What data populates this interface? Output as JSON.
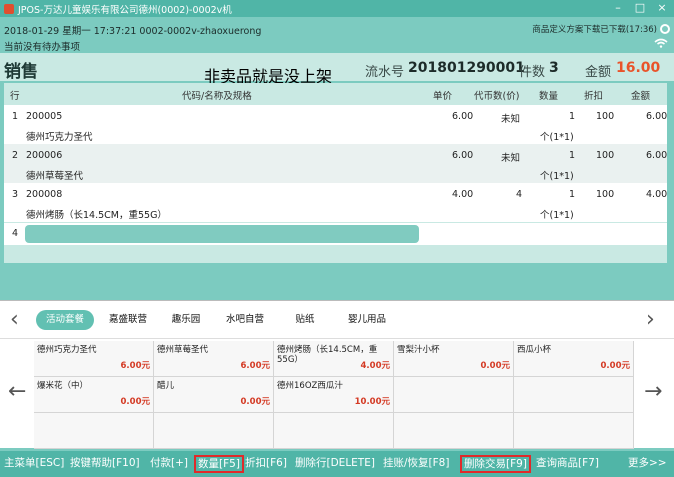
{
  "window": {
    "title": "JPOS-万达儿童娱乐有限公司德州(0002)-0002v机",
    "controls": [
      "–",
      "□",
      "×"
    ]
  },
  "info": {
    "line1": "2018-01-29 星期一 17:37:21 0002-0002v-zhaoxuerong",
    "line2": "当前没有待办事项",
    "sync": "商品定义方案下载已下载(17:36)"
  },
  "sales": {
    "title": "销售",
    "banner": "非卖品就是没上架",
    "serial_label": "流水号",
    "serial": "201801290001",
    "count_label": "件数",
    "count": "3",
    "amount_label": "金额",
    "amount": "16.00"
  },
  "table": {
    "headers": {
      "line": "行",
      "code_name": "代码/名称及规格",
      "price": "单价",
      "coupon": "代币数(价)",
      "qty": "数量",
      "discount": "折扣",
      "amount": "金额"
    },
    "rows": [
      {
        "no": "1",
        "code": "200005",
        "name": "德州巧克力圣代",
        "price": "6.00",
        "coupon": "未知",
        "qty": "1",
        "unit": "个(1*1)",
        "discount": "100",
        "amount": "6.00"
      },
      {
        "no": "2",
        "code": "200006",
        "name": "德州草莓圣代",
        "price": "6.00",
        "coupon": "未知",
        "qty": "1",
        "unit": "个(1*1)",
        "discount": "100",
        "amount": "6.00"
      },
      {
        "no": "3",
        "code": "200008",
        "name": "德州烤肠（长14.5CM，重55G）",
        "price": "4.00",
        "coupon": "4",
        "qty": "1",
        "unit": "个(1*1)",
        "discount": "100",
        "amount": "4.00"
      }
    ],
    "edit_row_no": "4"
  },
  "categories": [
    "活动套餐",
    "嘉盛联营",
    "趣乐园",
    "水吧自营",
    "贴纸",
    "婴儿用品"
  ],
  "products": [
    {
      "name": "德州巧克力圣代",
      "price": "6.00元"
    },
    {
      "name": "德州草莓圣代",
      "price": "6.00元"
    },
    {
      "name": "德州烤肠（长14.5CM，重55G）",
      "price": "4.00元"
    },
    {
      "name": "雪梨汁小杯",
      "price": "0.00元"
    },
    {
      "name": "西瓜小杯",
      "price": "0.00元"
    },
    {
      "name": "爆米花（中）",
      "price": "0.00元"
    },
    {
      "name": "醋儿",
      "price": "0.00元"
    },
    {
      "name": "德州16OZ西瓜汁",
      "price": "10.00元"
    }
  ],
  "function_keys": [
    {
      "label": "主菜单[ESC]",
      "hl": false
    },
    {
      "label": "按键帮助[F10]",
      "hl": false
    },
    {
      "label": "付款[+]",
      "hl": false
    },
    {
      "label": "数量[F5]",
      "hl": true
    },
    {
      "label": "折扣[F6]",
      "hl": false
    },
    {
      "label": "删除行[DELETE]",
      "hl": false
    },
    {
      "label": "挂账/恢复[F8]",
      "hl": false
    },
    {
      "label": "删除交易[F9]",
      "hl": true
    },
    {
      "label": "查询商品[F7]",
      "hl": false
    },
    {
      "label": "更多>>",
      "hl": false
    }
  ],
  "colors": {
    "accent": "#50b5a7",
    "amount": "#e9532a",
    "price": "#d43a24",
    "highlight_box": "#e02a2a"
  }
}
